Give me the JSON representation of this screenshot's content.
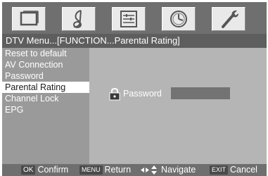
{
  "top_icons": [
    {
      "name": "picture-icon",
      "selected": false
    },
    {
      "name": "audio-icon",
      "selected": false
    },
    {
      "name": "setup-icon",
      "selected": false
    },
    {
      "name": "time-icon",
      "selected": false
    },
    {
      "name": "function-icon",
      "selected": true
    }
  ],
  "breadcrumb": "DTV Menu...[FUNCTION...Parental Rating]",
  "sidebar": {
    "items": [
      {
        "label": "Reset to default"
      },
      {
        "label": "AV Connection"
      },
      {
        "label": "Password"
      },
      {
        "label": "Parental Rating"
      },
      {
        "label": "Channel Lock"
      },
      {
        "label": "EPG"
      }
    ],
    "selected_index": 3
  },
  "main": {
    "password_label": "Password",
    "password_value": "",
    "lock_icon": "lock-icon"
  },
  "help_bar": {
    "ok_key": "OK",
    "ok_label": "Confirm",
    "menu_key": "MENU",
    "menu_label": "Return",
    "nav_label": "Navigate",
    "exit_key": "EXIT",
    "exit_label": "Cancel"
  },
  "colors": {
    "top_bar": "#6f6f6f",
    "breadcrumb_bg": "#5e5e5e",
    "sidebar_bg": "#9a9a9a",
    "main_bg": "#b5b5b5",
    "selected_item_bg": "#ffffff",
    "input_bg": "#737373"
  }
}
